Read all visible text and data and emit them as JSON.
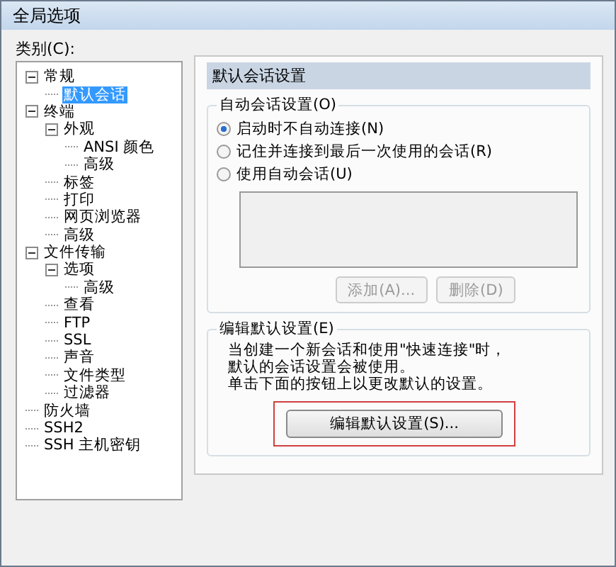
{
  "window": {
    "title": "全局选项"
  },
  "category_label": "类别(C):",
  "tree": [
    {
      "label": "常规",
      "selected": false,
      "expanded": true,
      "children": [
        {
          "label": "默认会话",
          "selected": true
        }
      ]
    },
    {
      "label": "终端",
      "selected": false,
      "expanded": true,
      "children": [
        {
          "label": "外观",
          "selected": false,
          "expanded": true,
          "children": [
            {
              "label": "ANSI 颜色",
              "selected": false
            },
            {
              "label": "高级",
              "selected": false
            }
          ]
        },
        {
          "label": "标签",
          "selected": false
        },
        {
          "label": "打印",
          "selected": false
        },
        {
          "label": "网页浏览器",
          "selected": false
        },
        {
          "label": "高级",
          "selected": false
        }
      ]
    },
    {
      "label": "文件传输",
      "selected": false,
      "expanded": true,
      "children": [
        {
          "label": "选项",
          "selected": false,
          "expanded": true,
          "children": [
            {
              "label": "高级",
              "selected": false
            }
          ]
        },
        {
          "label": "查看",
          "selected": false
        },
        {
          "label": "FTP",
          "selected": false
        },
        {
          "label": "SSL",
          "selected": false
        },
        {
          "label": "声音",
          "selected": false
        },
        {
          "label": "文件类型",
          "selected": false
        },
        {
          "label": "过滤器",
          "selected": false
        }
      ]
    },
    {
      "label": "防火墙",
      "selected": false
    },
    {
      "label": "SSH2",
      "selected": false
    },
    {
      "label": "SSH 主机密钥",
      "selected": false
    }
  ],
  "panel": {
    "header": "默认会话设置",
    "auto_session": {
      "title": "自动会话设置(O)",
      "options": [
        {
          "label": "启动时不自动连接(N)",
          "selected": true
        },
        {
          "label": "记住并连接到最后一次使用的会话(R)",
          "selected": false
        },
        {
          "label": "使用自动会话(U)",
          "selected": false
        }
      ],
      "buttons": [
        {
          "label": "添加(A)...",
          "disabled": true
        },
        {
          "label": "删除(D)",
          "disabled": true
        }
      ]
    },
    "edit_defaults": {
      "title": "编辑默认设置(E)",
      "lines": [
        "当创建一个新会话和使用\"快速连接\"时，",
        "默认的会话设置会被使用。",
        "单击下面的按钮上以更改默认的设置。"
      ],
      "button": "编辑默认设置(S)..."
    }
  }
}
